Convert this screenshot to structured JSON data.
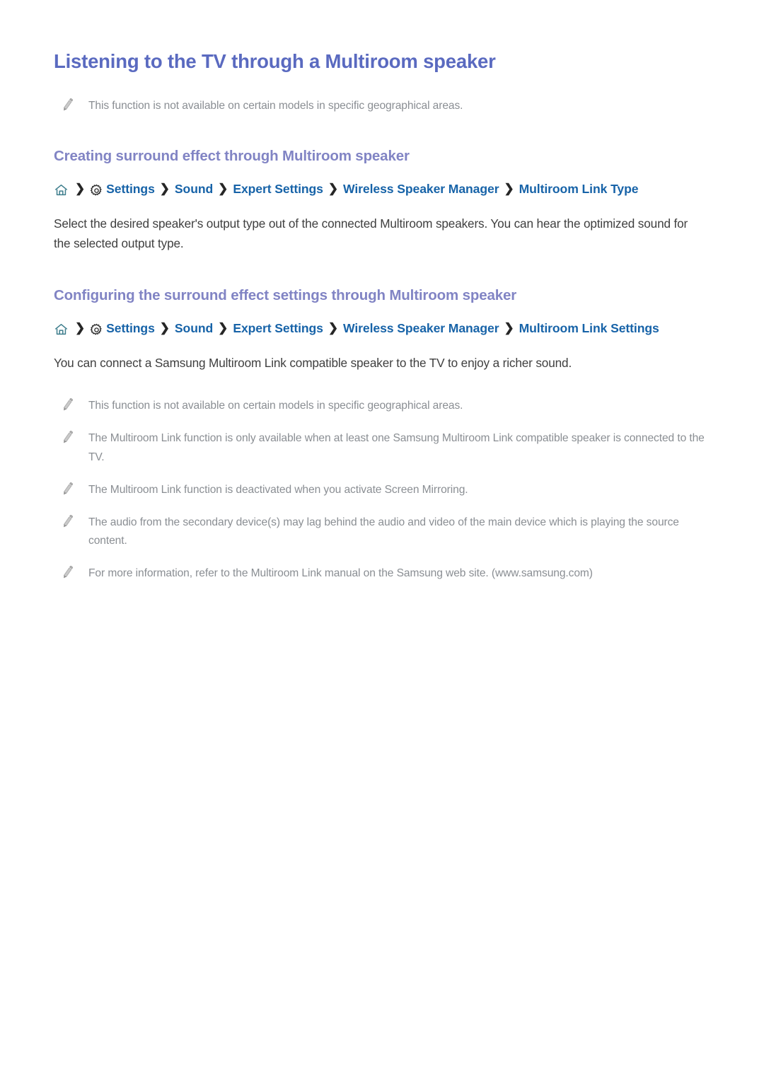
{
  "colors": {
    "page_title": "#5a6ac0",
    "section_heading": "#8184c4",
    "breadcrumb_link": "#1763a8",
    "breadcrumb_separator": "#262626",
    "note_text": "#8a8e93",
    "body_text": "#3f3f3f",
    "home_icon": "#3d7d8c",
    "gear_icon": "#2b2b2b",
    "pencil_icon": "#b3b3b3",
    "background": "#ffffff"
  },
  "page": {
    "title": "Listening to the TV through a Multiroom speaker"
  },
  "intro_notes": [
    {
      "icon": "pencil-icon",
      "text": "This function is not available on certain models in specific geographical areas."
    }
  ],
  "sections": [
    {
      "heading": "Creating surround effect through Multiroom speaker",
      "breadcrumb": {
        "home_icon": "home-icon",
        "gear_icon": "gear-icon",
        "separator": "›",
        "items": [
          "Settings",
          "Sound",
          "Expert Settings",
          "Wireless Speaker Manager",
          "Multiroom Link Type"
        ]
      },
      "body": "Select the desired speaker's output type out of the connected Multiroom speakers. You can hear the optimized sound for the selected output type.",
      "notes": []
    },
    {
      "heading": "Configuring the surround effect settings through Multiroom speaker",
      "breadcrumb": {
        "home_icon": "home-icon",
        "gear_icon": "gear-icon",
        "separator": "›",
        "items": [
          "Settings",
          "Sound",
          "Expert Settings",
          "Wireless Speaker Manager",
          "Multiroom Link Settings"
        ]
      },
      "body": "You can connect a Samsung Multiroom Link compatible speaker to the TV to enjoy a richer sound.",
      "notes": [
        {
          "icon": "pencil-icon",
          "text": "This function is not available on certain models in specific geographical areas."
        },
        {
          "icon": "pencil-icon",
          "text": "The Multiroom Link function is only available when at least one Samsung Multiroom Link compatible speaker is connected to the TV."
        },
        {
          "icon": "pencil-icon",
          "text": "The Multiroom Link function is deactivated when you activate Screen Mirroring."
        },
        {
          "icon": "pencil-icon",
          "text": "The audio from the secondary device(s) may lag behind the audio and video of the main device which is playing the source content."
        },
        {
          "icon": "pencil-icon",
          "text": "For more information, refer to the Multiroom Link manual on the Samsung web site. (www.samsung.com)"
        }
      ]
    }
  ]
}
